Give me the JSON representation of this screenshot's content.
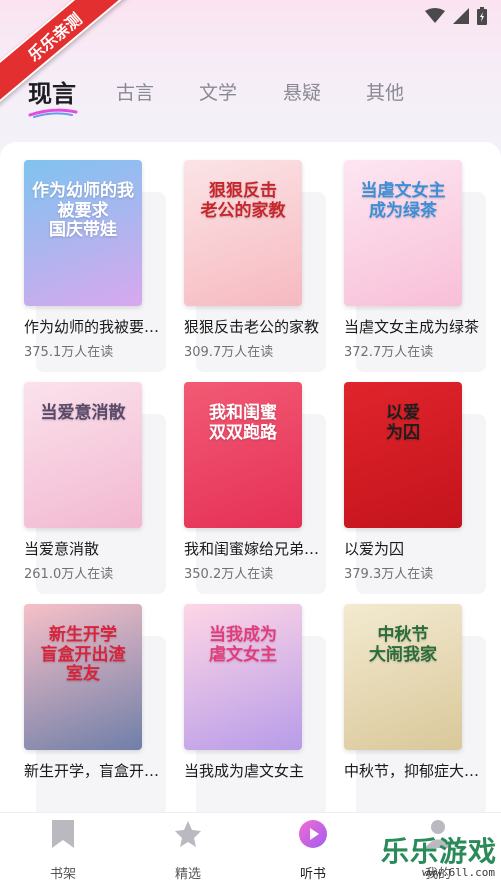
{
  "status_bar": {
    "icons": [
      "wifi-icon",
      "signal-icon",
      "battery-icon"
    ]
  },
  "ribbon": {
    "label": "乐乐亲测"
  },
  "tabs": [
    {
      "label": "现言",
      "active": true
    },
    {
      "label": "古言",
      "active": false
    },
    {
      "label": "文学",
      "active": false
    },
    {
      "label": "悬疑",
      "active": false
    },
    {
      "label": "其他",
      "active": false
    }
  ],
  "books": [
    {
      "title": "作为幼师的我被要求国庆带娃",
      "readers": "375.1万人在读",
      "cover_text": "作为幼师的我\n被要求\n国庆带娃",
      "cover_colors": [
        "#7fc3f0",
        "#d8a8ee"
      ],
      "text_color": "#ffffff"
    },
    {
      "title": "狠狠反击老公的家教",
      "readers": "309.7万人在读",
      "cover_text": "狠狠反击\n老公的家教",
      "cover_colors": [
        "#fbe4e6",
        "#f6b9c0"
      ],
      "text_color": "#c8262c"
    },
    {
      "title": "当虐文女主成为绿茶",
      "readers": "372.7万人在读",
      "cover_text": "当虐文女主\n成为绿茶",
      "cover_colors": [
        "#fde6f1",
        "#f8bfd8"
      ],
      "text_color": "#3b8ed8"
    },
    {
      "title": "当爱意消散",
      "readers": "261.0万人在读",
      "cover_text": "当爱意消散",
      "cover_colors": [
        "#fbe2ec",
        "#f2b8d0"
      ],
      "text_color": "#5a4a6a"
    },
    {
      "title": "我和闺蜜嫁给兄弟俩后双双跑路",
      "readers": "350.2万人在读",
      "cover_text": "我和闺蜜\n双双跑路",
      "cover_colors": [
        "#f25a74",
        "#e53056"
      ],
      "text_color": "#ffffff"
    },
    {
      "title": "以爱为囚",
      "readers": "379.3万人在读",
      "cover_text": "以爱\n为囚",
      "cover_colors": [
        "#e0242c",
        "#c4141c"
      ],
      "text_color": "#1e1e1e"
    },
    {
      "title": "新生开学，盲盒开出渣男室友",
      "readers": "",
      "cover_text": "新生开学\n盲盒开出渣\n室友",
      "cover_colors": [
        "#f7c0c8",
        "#6f7fa8"
      ],
      "text_color": "#d8233c"
    },
    {
      "title": "当我成为虐文女主",
      "readers": "",
      "cover_text": "当我成为\n虐文女主",
      "cover_colors": [
        "#ffd6e6",
        "#b79ce8"
      ],
      "text_color": "#e23c7c"
    },
    {
      "title": "中秋节，抑郁症大闹我家",
      "readers": "",
      "cover_text": "中秋节\n大闹我家",
      "cover_colors": [
        "#f3ead0",
        "#d9c89a"
      ],
      "text_color": "#2a6d3a"
    }
  ],
  "bottom_nav": [
    {
      "label": "书架",
      "icon": "bookmark-icon",
      "active": false
    },
    {
      "label": "精选",
      "icon": "star-icon",
      "active": false
    },
    {
      "label": "听书",
      "icon": "play-icon",
      "active": true
    },
    {
      "label": "我的",
      "icon": "person-icon",
      "active": false
    }
  ],
  "watermark": {
    "text": "乐乐游戏",
    "url": "www.6ll.com"
  },
  "colors": {
    "accent": "#e04fd7",
    "active_tab": "#1c1c22",
    "inactive_tab": "#8a8a93"
  }
}
